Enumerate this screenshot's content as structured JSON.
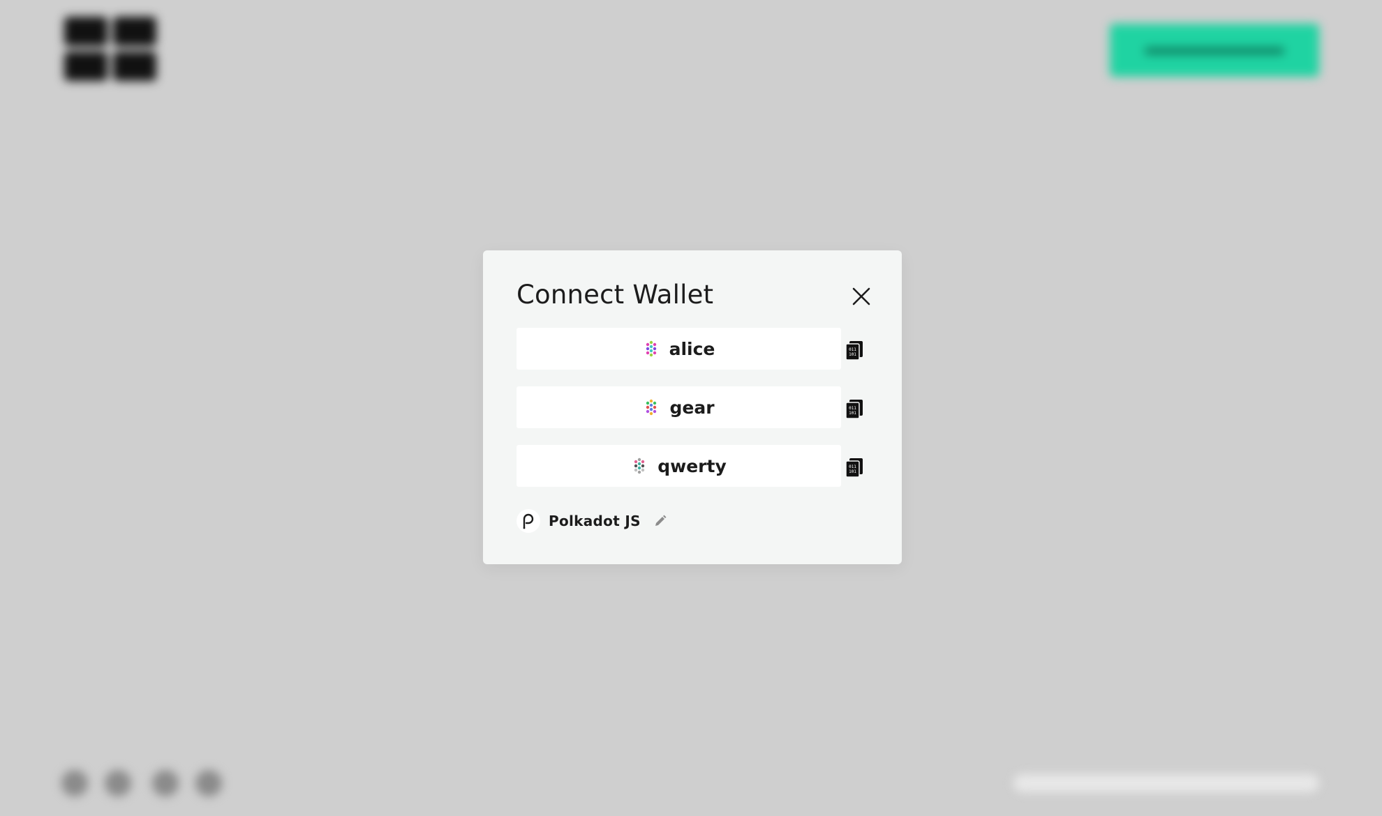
{
  "modal": {
    "title": "Connect Wallet",
    "close_icon": "close-icon",
    "accounts": [
      {
        "name": "alice",
        "identicon": "polkadot-identicon",
        "copy_icon": "copy-address-icon"
      },
      {
        "name": "gear",
        "identicon": "polkadot-identicon",
        "copy_icon": "copy-address-icon"
      },
      {
        "name": "qwerty",
        "identicon": "polkadot-identicon",
        "copy_icon": "copy-address-icon"
      }
    ],
    "wallet": {
      "name": "Polkadot JS",
      "logo_icon": "polkadot-js-icon",
      "edit_icon": "pencil-icon"
    }
  },
  "colors": {
    "backdrop": "#cfcfcf",
    "modal_bg": "#f4f6f5",
    "row_bg": "#ffffff",
    "accent": "#1fd3a2",
    "text": "#1c1c1c"
  }
}
